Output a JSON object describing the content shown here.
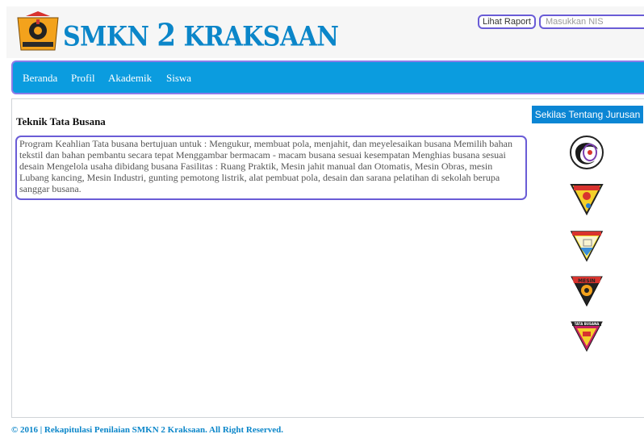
{
  "header": {
    "brand_text": "SMKN ",
    "brand_number": "2",
    "brand_rest": " KRAKSAAN",
    "raport_button_label": "Lihat Raport",
    "nis_placeholder": "Masukkan NIS",
    "logo_icon": "school-emblem-icon"
  },
  "navbar": {
    "items": [
      {
        "label": "Beranda"
      },
      {
        "label": "Profil"
      },
      {
        "label": "Akademik"
      },
      {
        "label": "Siswa"
      }
    ]
  },
  "content": {
    "title": "Teknik Tata Busana",
    "body": "Program Keahlian Tata busana bertujuan untuk : Mengukur, membuat pola, menjahit, dan meyelesaikan busana Memilih bahan tekstil dan bahan pembantu secara tepat Menggambar bermacam - macam busana sesuai kesempatan Menghias busana sesuai desain Mengelola usaha dibidang busana Fasilitas : Ruang Praktik, Mesin jahit manual dan Otomatis, Mesin Obras, mesin Lubang kancing, Mesin Industri, gunting pemotong listrik, alat pembuat pola, desain dan sarana pelatihan di sekolah berupa sanggar busana."
  },
  "sidebar": {
    "button_label": "Sekilas Tentang Jurusan",
    "department_logos": [
      {
        "icon": "department-logo-1-icon"
      },
      {
        "icon": "department-logo-2-icon"
      },
      {
        "icon": "department-logo-3-icon"
      },
      {
        "icon": "mesin-department-logo-icon",
        "text": "MESIN"
      },
      {
        "icon": "tata-busana-department-logo-icon",
        "text": "TATA BUSANA"
      }
    ]
  },
  "footer": {
    "text": "© 2016 | Rekapitulasi Penilaian SMKN 2 Kraksaan. All Right Reserved."
  },
  "colors": {
    "brand_blue": "#0b86c9",
    "nav_blue": "#0b9cdf",
    "border_purple": "#6a5cd6"
  }
}
